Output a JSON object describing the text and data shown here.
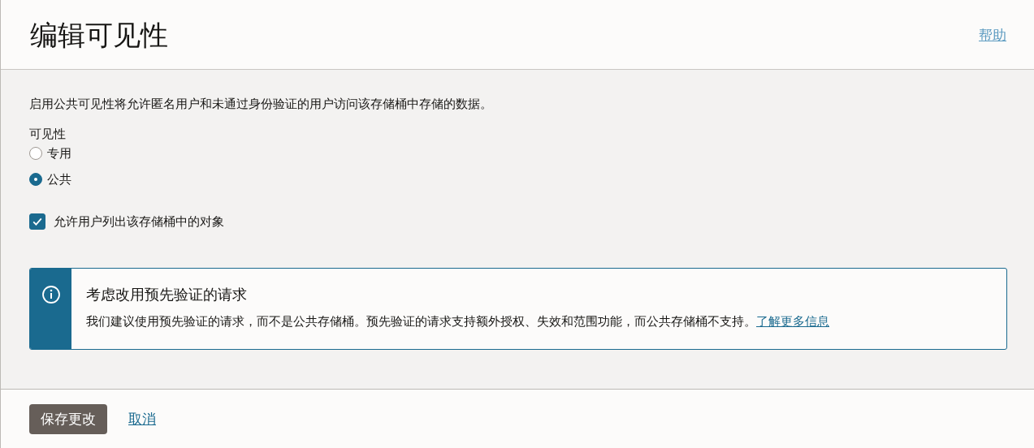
{
  "header": {
    "title": "编辑可见性",
    "help_link": "帮助"
  },
  "description": "启用公共可见性将允许匿名用户和未通过身份验证的用户访问该存储桶中存储的数据。",
  "visibility": {
    "label": "可见性",
    "options": [
      {
        "label": "专用",
        "selected": false
      },
      {
        "label": "公共",
        "selected": true
      }
    ]
  },
  "list_objects": {
    "label": "允许用户列出该存储桶中的对象",
    "checked": true
  },
  "info_box": {
    "title": "考虑改用预先验证的请求",
    "message": "我们建议使用预先验证的请求，而不是公共存储桶。预先验证的请求支持额外授权、失效和范围功能，而公共存储桶不支持。",
    "link": "了解更多信息"
  },
  "footer": {
    "buttons": [
      {
        "kind": "primary",
        "label": "保存更改"
      },
      {
        "kind": "link",
        "label": "取消"
      }
    ]
  }
}
